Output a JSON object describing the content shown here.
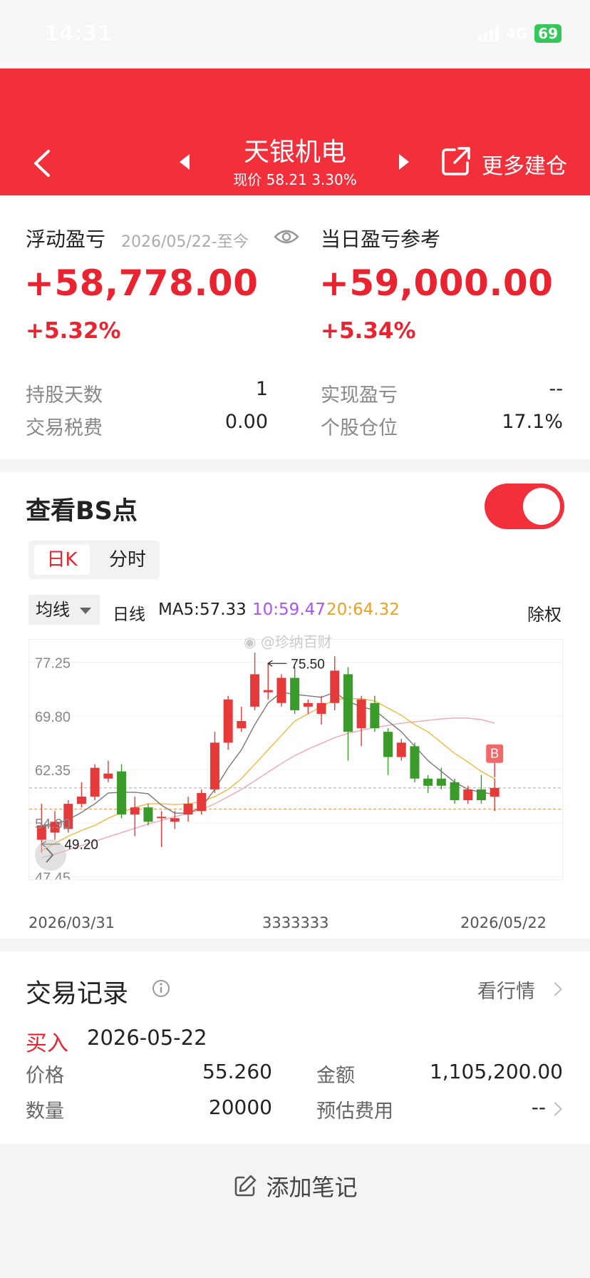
{
  "status_bar": {
    "time": "14:31",
    "network": "4G",
    "battery": "69"
  },
  "header": {
    "stock_name": "天银机电",
    "price_line": "现价 58.21 3.30%",
    "more_build": "更多建仓"
  },
  "pnl": {
    "floating_label": "浮动盈亏",
    "floating_date": "2026/05/22-至今",
    "floating_value": "+58,778.00",
    "floating_pct": "+5.32%",
    "daily_label": "当日盈亏参考",
    "daily_value": "+59,000.00",
    "daily_pct": "+5.34%",
    "hold_days_label": "持股天数",
    "hold_days_value": "1",
    "fee_label": "交易税费",
    "fee_value": "0.00",
    "realized_label": "实现盈亏",
    "realized_value": "--",
    "position_label": "个股仓位",
    "position_value": "17.1%"
  },
  "bs": {
    "title": "查看BS点",
    "tab_day": "日K",
    "tab_minute": "分时",
    "ma_dropdown": "均线",
    "ma_line_label": "日线",
    "ma5": "MA5:57.33",
    "ma10": "10:59.47",
    "ma20": "20:64.32",
    "ex_right": "除权",
    "watermark": "@珍纳百财",
    "marker_b": "B",
    "date_start": "2026/03/31",
    "date_mid": "3333333",
    "date_end": "2026/05/22",
    "colors": {
      "up": "#e63a3a",
      "down": "#3a9a2a",
      "ma5": "#777777",
      "ma10": "#f5b73b",
      "ma20": "#f6a5b0"
    }
  },
  "chart_data": {
    "type": "candlestick",
    "y_tick_labels": [
      "77.25",
      "69.80",
      "62.35",
      "54.90",
      "47.45"
    ],
    "ylim": [
      45.5,
      78.8
    ],
    "high_annotation": "75.50",
    "low_annotation": "49.20",
    "candles": [
      {
        "o": 51.0,
        "c": 53.0,
        "h": 56.0,
        "l": 49.2
      },
      {
        "o": 52.0,
        "c": 53.5,
        "h": 55.0,
        "l": 51.0
      },
      {
        "o": 52.5,
        "c": 56.0,
        "h": 56.5,
        "l": 52.0
      },
      {
        "o": 56.0,
        "c": 57.0,
        "h": 59.0,
        "l": 55.5
      },
      {
        "o": 57.0,
        "c": 61.0,
        "h": 61.5,
        "l": 56.5
      },
      {
        "o": 59.5,
        "c": 60.2,
        "h": 62.0,
        "l": 59.0
      },
      {
        "o": 60.5,
        "c": 54.5,
        "h": 61.5,
        "l": 54.0
      },
      {
        "o": 54.5,
        "c": 55.5,
        "h": 57.0,
        "l": 51.5
      },
      {
        "o": 55.5,
        "c": 53.5,
        "h": 56.0,
        "l": 53.0
      },
      {
        "o": 54.0,
        "c": 54.2,
        "h": 55.0,
        "l": 50.0
      },
      {
        "o": 53.5,
        "c": 54.0,
        "h": 55.0,
        "l": 52.5
      },
      {
        "o": 54.5,
        "c": 56.0,
        "h": 57.0,
        "l": 53.5
      },
      {
        "o": 55.0,
        "c": 57.5,
        "h": 58.0,
        "l": 54.5
      },
      {
        "o": 58.0,
        "c": 64.5,
        "h": 66.0,
        "l": 57.5
      },
      {
        "o": 64.5,
        "c": 70.5,
        "h": 71.0,
        "l": 63.5
      },
      {
        "o": 66.5,
        "c": 67.5,
        "h": 69.5,
        "l": 66.0
      },
      {
        "o": 69.5,
        "c": 74.0,
        "h": 77.0,
        "l": 69.0
      },
      {
        "o": 71.5,
        "c": 71.8,
        "h": 75.5,
        "l": 70.5
      },
      {
        "o": 70.0,
        "c": 73.5,
        "h": 74.0,
        "l": 69.5
      },
      {
        "o": 73.5,
        "c": 69.0,
        "h": 75.0,
        "l": 68.5
      },
      {
        "o": 69.5,
        "c": 70.0,
        "h": 70.5,
        "l": 68.5
      },
      {
        "o": 68.5,
        "c": 70.0,
        "h": 71.0,
        "l": 67.0
      },
      {
        "o": 70.0,
        "c": 74.5,
        "h": 76.5,
        "l": 69.0
      },
      {
        "o": 74.0,
        "c": 66.0,
        "h": 75.0,
        "l": 62.0
      },
      {
        "o": 66.5,
        "c": 70.5,
        "h": 71.0,
        "l": 64.0
      },
      {
        "o": 70.0,
        "c": 66.5,
        "h": 71.0,
        "l": 66.0
      },
      {
        "o": 66.0,
        "c": 62.5,
        "h": 66.5,
        "l": 60.0
      },
      {
        "o": 62.5,
        "c": 64.5,
        "h": 65.0,
        "l": 62.0
      },
      {
        "o": 64.0,
        "c": 59.5,
        "h": 64.5,
        "l": 59.0
      },
      {
        "o": 59.5,
        "c": 58.5,
        "h": 60.0,
        "l": 57.5
      },
      {
        "o": 59.5,
        "c": 58.5,
        "h": 61.0,
        "l": 58.0
      },
      {
        "o": 59.0,
        "c": 56.5,
        "h": 59.5,
        "l": 56.0
      },
      {
        "o": 56.5,
        "c": 58.0,
        "h": 58.5,
        "l": 56.0
      },
      {
        "o": 58.0,
        "c": 56.5,
        "h": 60.0,
        "l": 56.0
      },
      {
        "o": 57.0,
        "c": 58.21,
        "h": 59.5,
        "l": 55.0
      }
    ],
    "ma5": [
      53.0,
      53.2,
      53.8,
      54.8,
      56.0,
      57.5,
      57.6,
      57.6,
      57.4,
      55.8,
      54.7,
      54.7,
      55.5,
      58.0,
      61.0,
      63.5,
      67.0,
      70.0,
      71.5,
      71.2,
      71.0,
      70.8,
      71.5,
      70.2,
      69.5,
      69.0,
      67.5,
      66.0,
      64.0,
      62.0,
      60.5,
      59.0,
      58.0,
      57.6,
      57.33
    ],
    "ma10": [
      49.5,
      50.5,
      51.5,
      52.3,
      53.0,
      54.0,
      54.8,
      55.5,
      56.0,
      56.0,
      55.9,
      56.0,
      56.3,
      57.0,
      58.0,
      59.5,
      61.5,
      63.5,
      65.5,
      67.5,
      68.5,
      69.5,
      70.5,
      70.6,
      70.6,
      70.3,
      69.3,
      68.3,
      67.0,
      66.0,
      64.5,
      63.0,
      61.8,
      60.5,
      59.47
    ],
    "ma20": [
      48.5,
      49.0,
      49.6,
      50.2,
      50.8,
      51.4,
      52.0,
      52.6,
      53.2,
      53.7,
      54.2,
      54.7,
      55.2,
      56.0,
      57.0,
      58.0,
      59.2,
      60.4,
      61.6,
      62.7,
      63.6,
      64.4,
      65.2,
      65.8,
      66.2,
      66.6,
      66.9,
      67.2,
      67.4,
      67.6,
      67.8,
      67.9,
      67.9,
      67.7,
      67.2
    ],
    "dashed_levels": [
      {
        "value": 58.21,
        "color": "#bbbbbb"
      },
      {
        "value": 55.26,
        "color": "#f5a25a"
      }
    ],
    "b_marker_candle_index": 34
  },
  "trades": {
    "title": "交易记录",
    "market_link": "看行情",
    "type": "买入",
    "date": "2026-05-22",
    "price_label": "价格",
    "price_value": "55.260",
    "amount_label": "金额",
    "amount_value": "1,105,200.00",
    "qty_label": "数量",
    "qty_value": "20000",
    "fee_label": "预估费用",
    "fee_value": "--"
  },
  "add_note": "添加笔记"
}
